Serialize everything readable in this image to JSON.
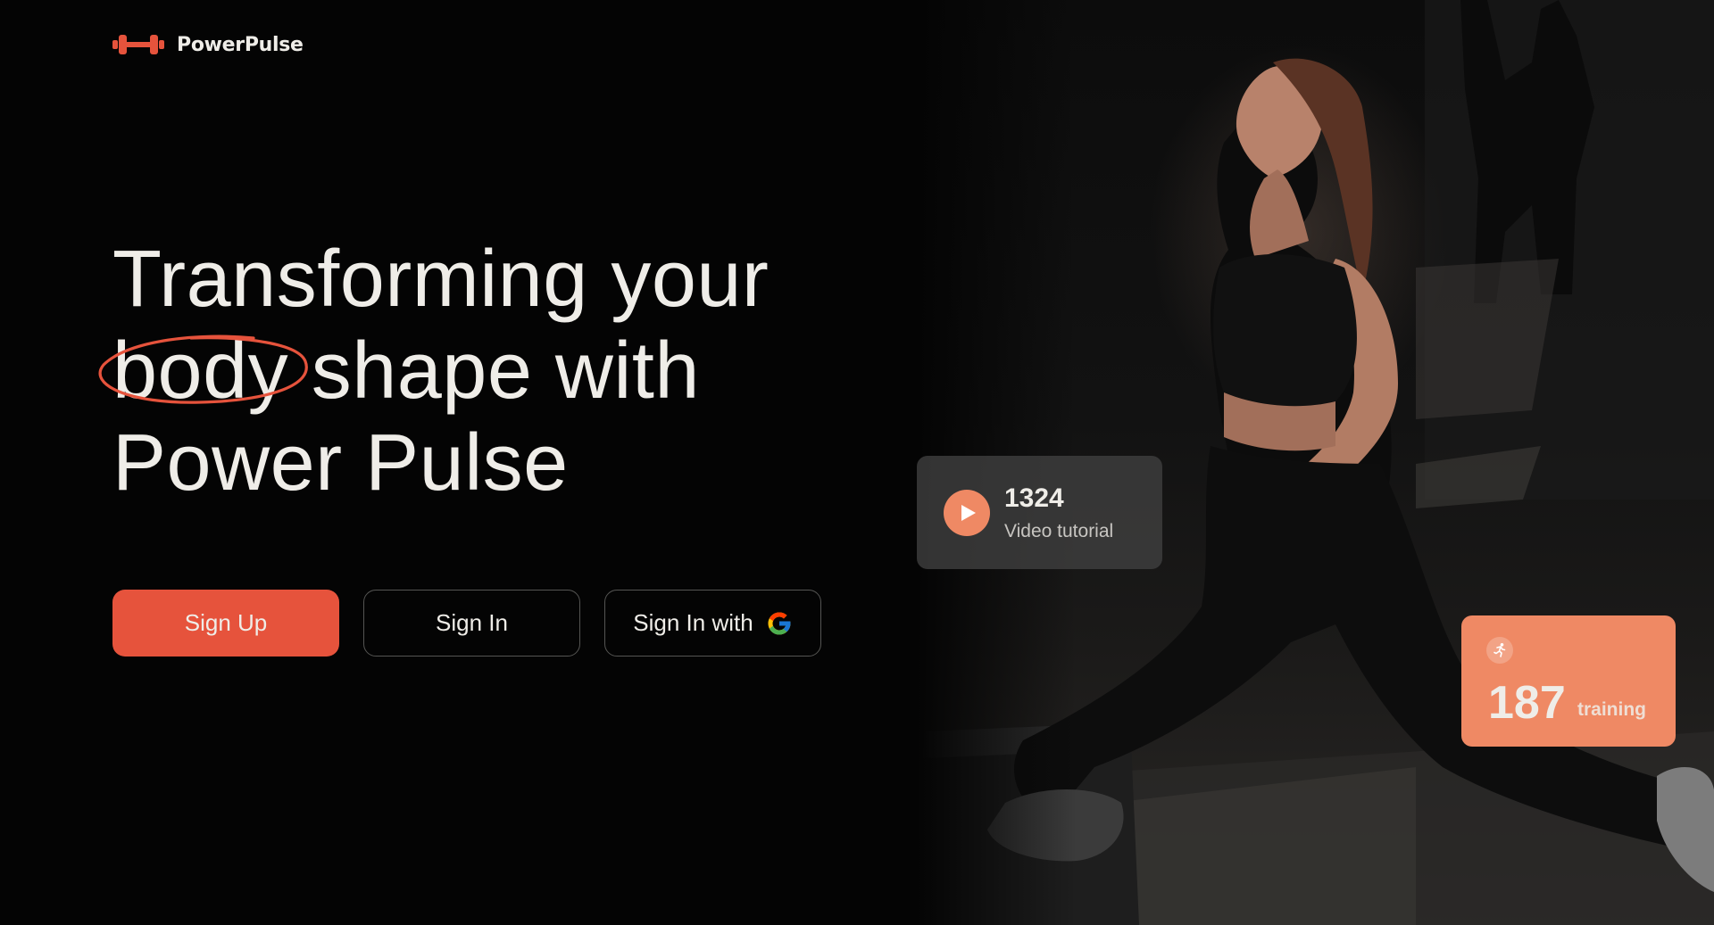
{
  "brand": {
    "name": "PowerPulse",
    "logo_icon": "dumbbell-icon",
    "accent": "#E6533C",
    "accent_light": "#EF8964"
  },
  "hero": {
    "headline_line1": "Transforming your",
    "headline_highlight": "body",
    "headline_line2_rest": "shape with",
    "headline_line3": "Power Pulse"
  },
  "actions": {
    "sign_up": "Sign Up",
    "sign_in": "Sign In",
    "sign_in_google": "Sign In with",
    "google_icon": "google-icon"
  },
  "stats": {
    "video": {
      "value": "1324",
      "label": "Video tutorial",
      "icon": "play-icon"
    },
    "training": {
      "value": "187",
      "label": "training",
      "icon": "runner-icon"
    }
  },
  "colors": {
    "background": "#040404",
    "text": "#EFEDE8",
    "card_dark": "#3E3E3E"
  }
}
